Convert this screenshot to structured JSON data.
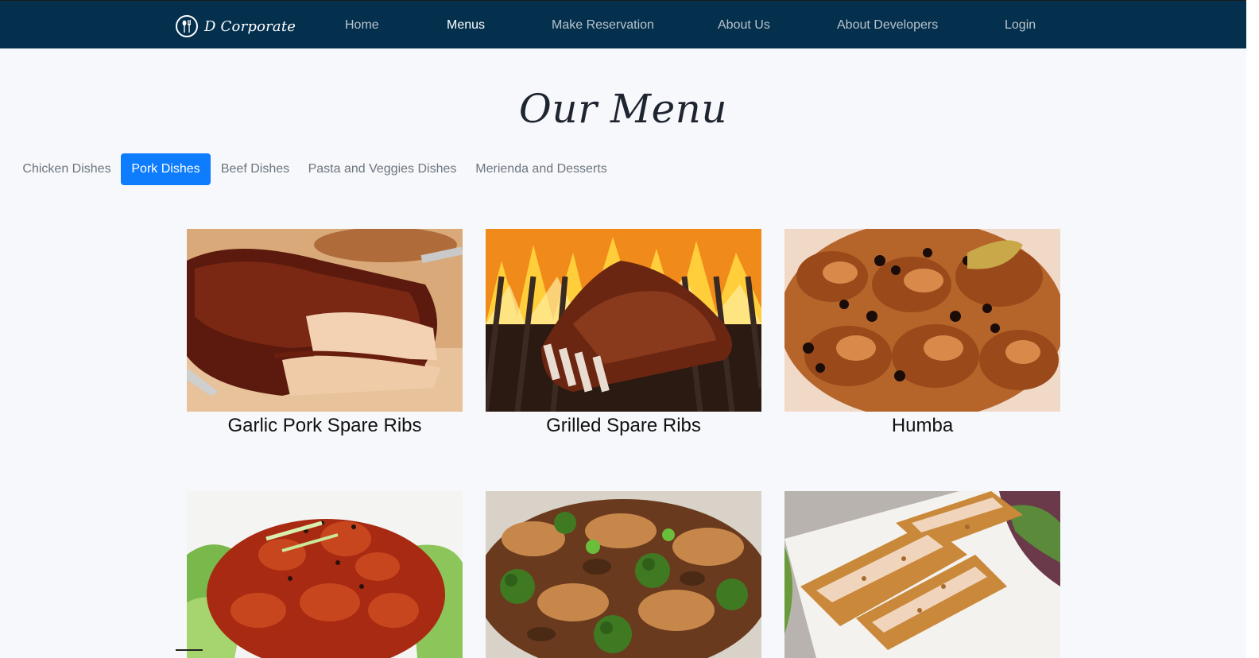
{
  "brand": {
    "name": "D Corporate",
    "logo_icon": "fork-spoon-logo-icon"
  },
  "nav": {
    "items": [
      {
        "label": "Home",
        "active": false
      },
      {
        "label": "Menus",
        "active": true
      },
      {
        "label": "Make Reservation",
        "active": false
      },
      {
        "label": "About Us",
        "active": false
      },
      {
        "label": "About Developers",
        "active": false
      },
      {
        "label": "Login",
        "active": false
      }
    ]
  },
  "page": {
    "title": "Our Menu"
  },
  "tabs": [
    {
      "label": "Chicken Dishes",
      "active": false
    },
    {
      "label": "Pork Dishes",
      "active": true
    },
    {
      "label": "Beef Dishes",
      "active": false
    },
    {
      "label": "Pasta and Veggies Dishes",
      "active": false
    },
    {
      "label": "Merienda and Desserts",
      "active": false
    }
  ],
  "dishes": [
    {
      "name": "Garlic Pork Spare Ribs",
      "image": "pork-ribs-photo"
    },
    {
      "name": "Grilled Spare Ribs",
      "image": "grilled-ribs-photo"
    },
    {
      "name": "Humba",
      "image": "humba-photo"
    },
    {
      "name": "",
      "image": "sweet-spicy-pork-photo"
    },
    {
      "name": "",
      "image": "pork-broccoli-stirfry-photo"
    },
    {
      "name": "",
      "image": "breaded-pork-cutlet-photo"
    }
  ],
  "colors": {
    "navbar": "#04304d",
    "accent": "#0d7cfd",
    "background": "#f7f8fc"
  }
}
